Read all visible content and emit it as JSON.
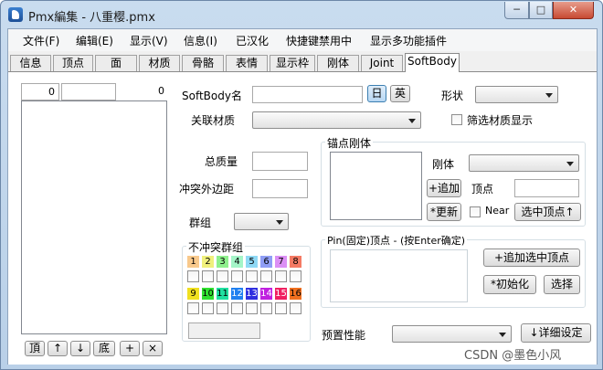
{
  "window": {
    "title": "Pmx編集 - 八重樱.pmx",
    "min_label": "─",
    "max_label": "□",
    "close_label": "✕"
  },
  "menu": [
    "文件(F)",
    "编辑(E)",
    "显示(V)",
    "信息(I)",
    "已汉化",
    "快捷键禁用中",
    "显示多功能插件"
  ],
  "tabs": [
    "信息",
    "顶点",
    "面",
    "材质",
    "骨骼",
    "表情",
    "显示枠",
    "刚体",
    "Joint",
    "SoftBody"
  ],
  "left": {
    "index_value": "0",
    "count_value": "0",
    "buttons": [
      "頂",
      "↑",
      "↓",
      "底",
      "+",
      "×"
    ]
  },
  "softbody": {
    "name_label": "SoftBody名",
    "lang_jp": "日",
    "lang_en": "英",
    "shape_label": "形状",
    "material_label": "关联材质",
    "filter_label": "筛选材质显示",
    "mass_label": "总质量",
    "margin_label": "冲突外边距",
    "group_label": "群组",
    "collision_group_title": "不冲突群组",
    "group_numbers": [
      "1",
      "2",
      "3",
      "4",
      "5",
      "6",
      "7",
      "8",
      "9",
      "10",
      "11",
      "12",
      "13",
      "14",
      "15",
      "16"
    ],
    "anchor_title": "锚点刚体",
    "rigid_label": "刚体",
    "vertex_label": "顶点",
    "add_button": "+追加",
    "update_button": "*更新",
    "near_label": "Near",
    "select_vertex_button": "选中顶点↑",
    "pin_title": "Pin(固定)顶点 - (按Enter确定)",
    "add_selected_button": "+追加选中顶点",
    "init_button": "*初始化",
    "select_button": "选择",
    "preset_label": "预置性能",
    "detail_button": "↓详细设定"
  },
  "watermark": "CSDN @墨色小风",
  "colors": {
    "accent": "#3a7fd0"
  }
}
